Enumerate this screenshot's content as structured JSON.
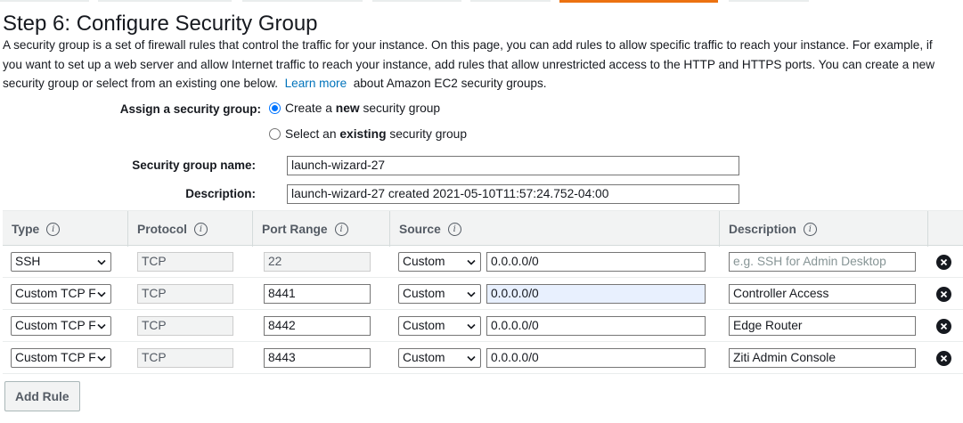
{
  "step": {
    "title": "Step 6: Configure Security Group",
    "intro_line1": "A security group is a set of firewall rules that control the traffic for your instance. On this page, you can add rules to allow specific traffic to reach your instance. For example, if",
    "intro_line2": "you want to set up a web server and allow Internet traffic to reach your instance, add rules that allow unrestricted access to the HTTP and HTTPS ports. You can create a new",
    "intro_line3_before": "security group or select from an existing one below.",
    "learn_more": "Learn more",
    "intro_line3_after": "about Amazon EC2 security groups."
  },
  "assign": {
    "label": "Assign a security group:",
    "option_new_prefix": "Create a ",
    "option_new_bold": "new",
    "option_new_suffix": " security group",
    "option_existing_prefix": "Select an ",
    "option_existing_bold": "existing",
    "option_existing_suffix": " security group",
    "selected": "new"
  },
  "group": {
    "name_label": "Security group name:",
    "name_value": "launch-wizard-27",
    "description_label": "Description:",
    "description_value": "launch-wizard-27 created 2021-05-10T11:57:24.752-04:00"
  },
  "table": {
    "headers": {
      "type": "Type",
      "protocol": "Protocol",
      "port_range": "Port Range",
      "source": "Source",
      "description": "Description"
    },
    "info_glyph": "i",
    "rows": [
      {
        "type": "SSH",
        "protocol": "TCP",
        "port": "22",
        "source_type": "Custom",
        "source_value": "0.0.0.0/0",
        "description": "",
        "description_placeholder": "e.g. SSH for Admin Desktop"
      },
      {
        "type": "Custom TCP F",
        "protocol": "TCP",
        "port": "8441",
        "source_type": "Custom",
        "source_value": "0.0.0.0/0",
        "description": "Controller Access",
        "description_placeholder": ""
      },
      {
        "type": "Custom TCP F",
        "protocol": "TCP",
        "port": "8442",
        "source_type": "Custom",
        "source_value": "0.0.0.0/0",
        "description": "Edge Router",
        "description_placeholder": ""
      },
      {
        "type": "Custom TCP F",
        "protocol": "TCP",
        "port": "8443",
        "source_type": "Custom",
        "source_value": "0.0.0.0/0",
        "description": "Ziti Admin Console",
        "description_placeholder": ""
      }
    ]
  },
  "add_rule_label": "Add Rule",
  "icons": {
    "info": "info-icon",
    "remove": "remove-rule-icon",
    "dropdown": "chevron-down-icon"
  },
  "colors": {
    "link": "#0073bb",
    "accent_tab": "#ec7211",
    "radio_selected": "#0075ff",
    "focused_field": "#e8f0fe"
  }
}
